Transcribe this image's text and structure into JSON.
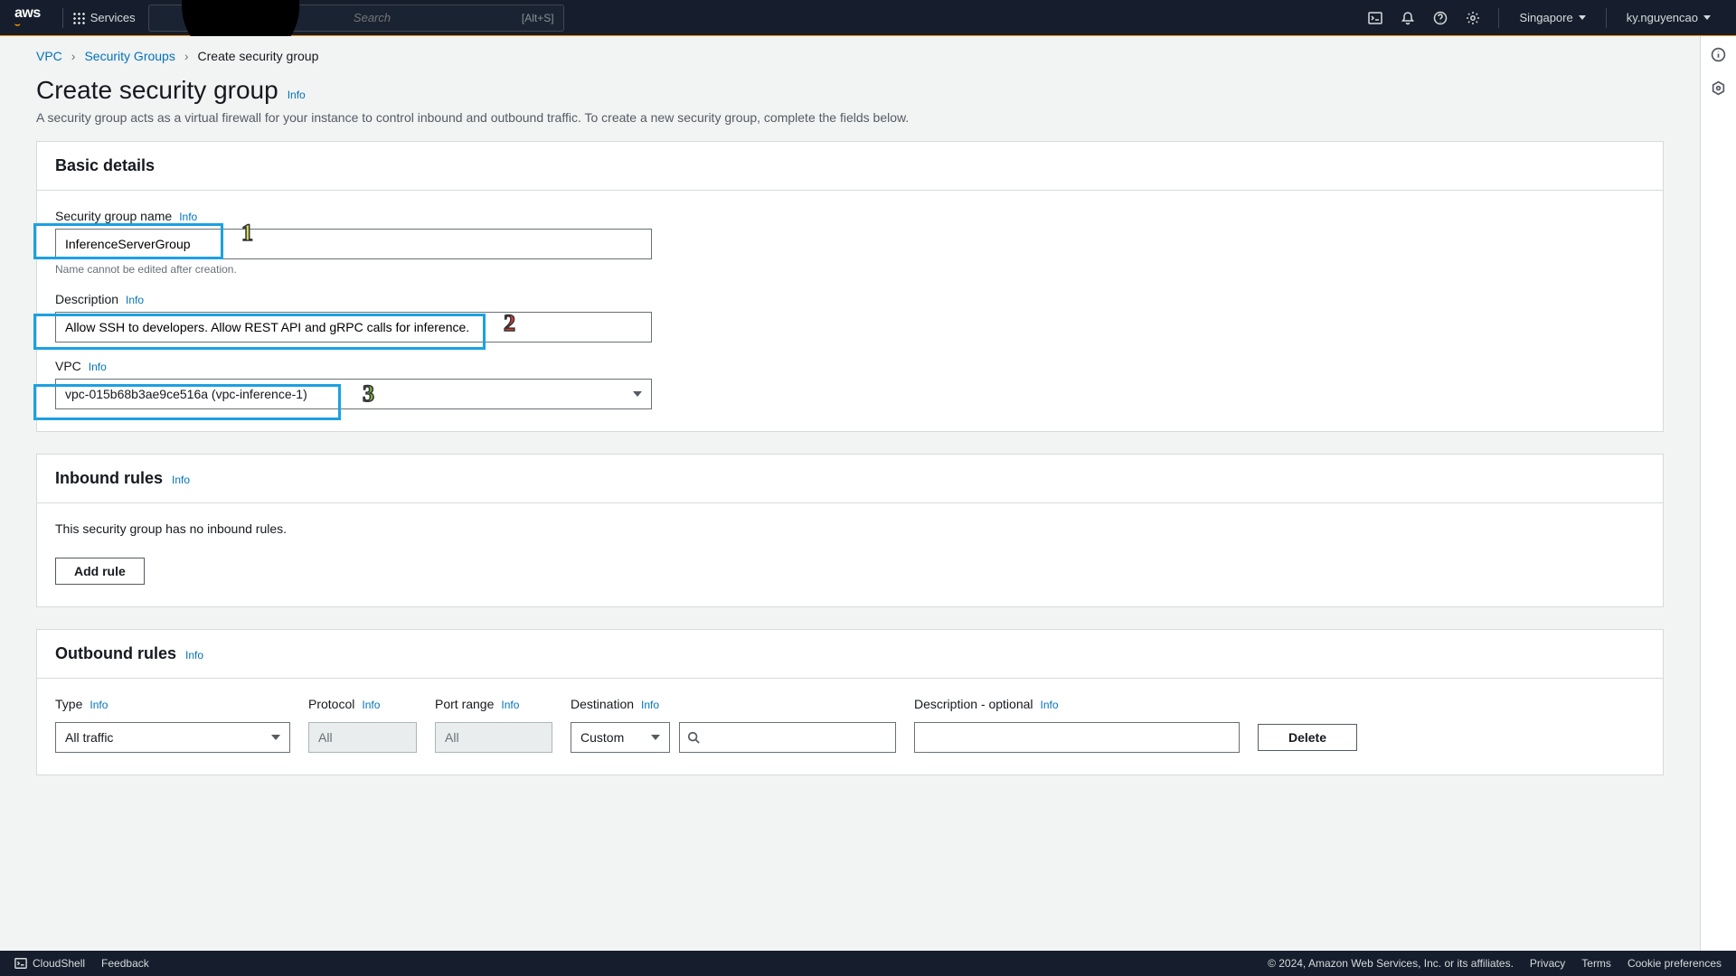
{
  "nav": {
    "logo": "aws",
    "services": "Services",
    "search_placeholder": "Search",
    "search_hint": "[Alt+S]",
    "region": "Singapore",
    "user": "ky.nguyencao"
  },
  "crumbs": {
    "vpc": "VPC",
    "sg": "Security Groups",
    "current": "Create security group"
  },
  "header": {
    "title": "Create security group",
    "info": "Info",
    "subtitle": "A security group acts as a virtual firewall for your instance to control inbound and outbound traffic. To create a new security group, complete the fields below."
  },
  "basic": {
    "panel_title": "Basic details",
    "name_label": "Security group name",
    "name_value": "InferenceServerGroup",
    "name_hint": "Name cannot be edited after creation.",
    "desc_label": "Description",
    "desc_value": "Allow SSH to developers. Allow REST API and gRPC calls for inference.",
    "vpc_label": "VPC",
    "vpc_value": "vpc-015b68b3ae9ce516a (vpc-inference-1)",
    "info": "Info"
  },
  "inbound": {
    "panel_title": "Inbound rules",
    "info": "Info",
    "empty": "This security group has no inbound rules.",
    "add_rule": "Add rule"
  },
  "outbound": {
    "panel_title": "Outbound rules",
    "info": "Info",
    "cols": {
      "type": "Type",
      "protocol": "Protocol",
      "port": "Port range",
      "dest": "Destination",
      "desc": "Description - optional"
    },
    "row": {
      "type": "All traffic",
      "protocol": "All",
      "port": "All",
      "dest_mode": "Custom",
      "dest_value": "",
      "desc": "",
      "delete": "Delete"
    }
  },
  "footer": {
    "cloudshell": "CloudShell",
    "feedback": "Feedback",
    "copyright": "© 2024, Amazon Web Services, Inc. or its affiliates.",
    "privacy": "Privacy",
    "terms": "Terms",
    "cookies": "Cookie preferences"
  },
  "annotations": {
    "n1": "1",
    "n2": "2",
    "n3": "3"
  }
}
